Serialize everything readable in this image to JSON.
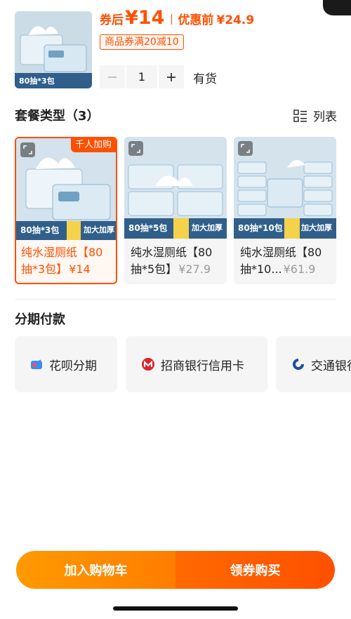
{
  "product": {
    "price_after_label": "券后",
    "price_after": "¥14",
    "price_before_label": "优惠前",
    "price_before": "¥24.9",
    "coupon": "商品券满20减10",
    "quantity": "1",
    "stock": "有货",
    "thumb_caption": "80抽*3包"
  },
  "packages": {
    "title": "套餐类型（3）",
    "list_toggle": "列表",
    "items": [
      {
        "name": "纯水湿厕纸【80抽*3包】",
        "price": "¥14",
        "badge": "千人加购",
        "caption": "80抽*3包"
      },
      {
        "name": "纯水湿厕纸【80抽*5包】",
        "price": "¥27.9",
        "caption": "80抽*5包"
      },
      {
        "name": "纯水湿厕纸【80抽*10...",
        "price": "¥61.9",
        "caption": "80抽*10包"
      }
    ],
    "image_extra": "加大加厚"
  },
  "installments": {
    "title": "分期付款",
    "options": [
      {
        "label": "花呗分期",
        "icon": "huabei-icon"
      },
      {
        "label": "招商银行信用卡",
        "icon": "cmb-bank-icon"
      },
      {
        "label": "交通银行",
        "icon": "bocom-bank-icon"
      }
    ]
  },
  "actions": {
    "add_to_cart": "加入购物车",
    "buy": "领券购买"
  },
  "colors": {
    "accent": "#ff5000",
    "cart_gradient_start": "#ff9a00",
    "buy_gradient_end": "#ff5000"
  }
}
